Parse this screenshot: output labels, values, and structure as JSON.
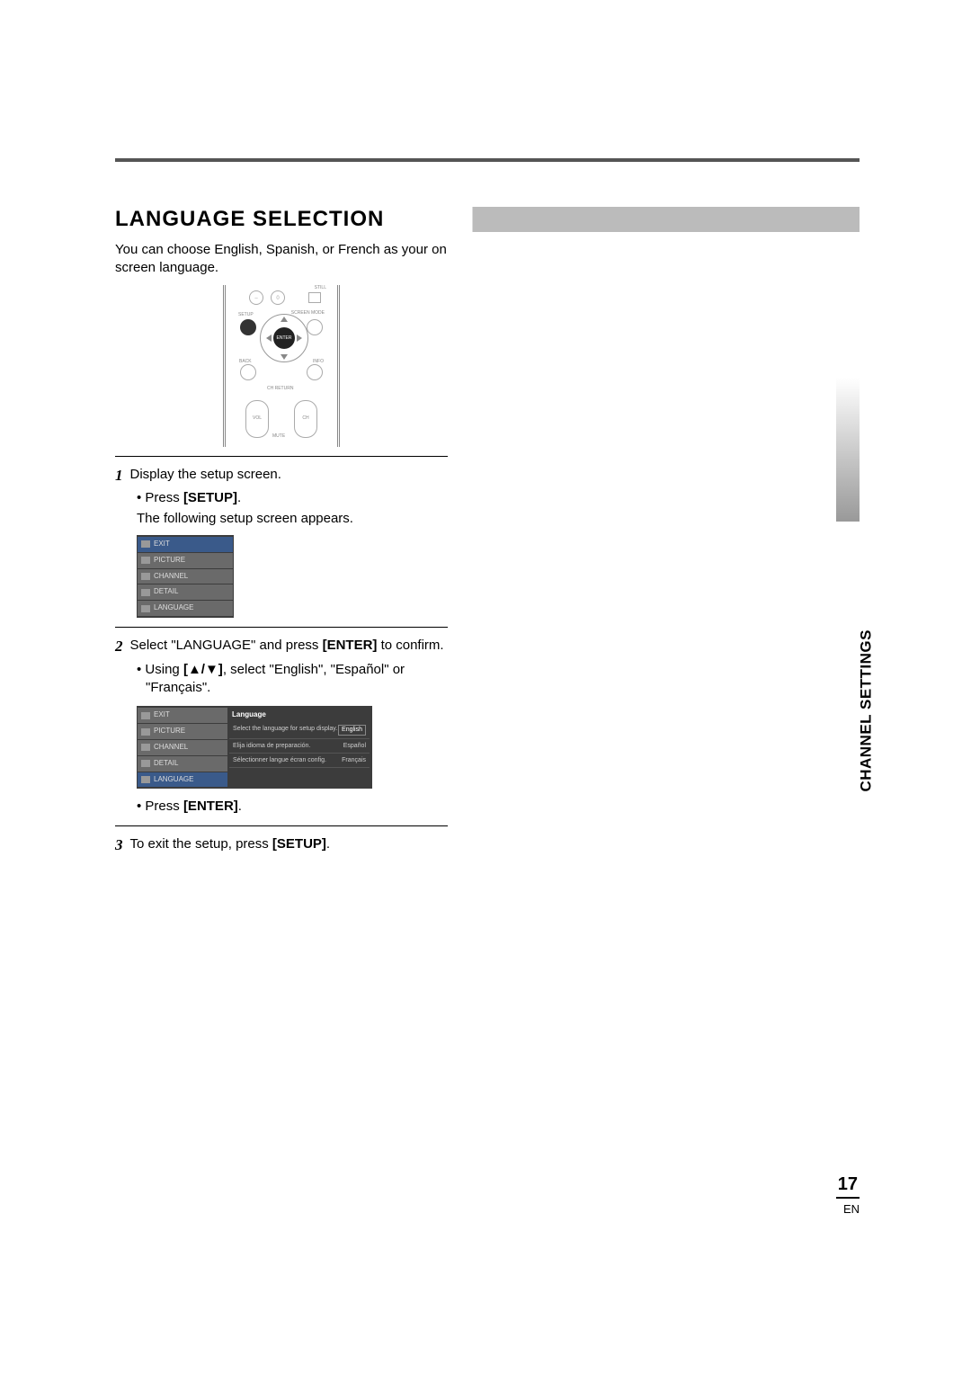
{
  "section_title": "LANGUAGE SELECTION",
  "intro": "You can choose English, Spanish, or French as your on screen language.",
  "remote": {
    "still": "STILL",
    "setup": "SETUP",
    "screen": "SCREEN MODE",
    "enter": "ENTER",
    "back": "BACK",
    "info": "INFO",
    "return": "CH RETURN",
    "vol": "VOL",
    "ch": "CH",
    "mute": "MUTE"
  },
  "step1": {
    "num": "1",
    "text": "Display the setup screen.",
    "bullet1a": "Press ",
    "bullet1b": "[SETUP]",
    "bullet1c": ".",
    "sub": "The following setup screen appears."
  },
  "menu": {
    "items": [
      "EXIT",
      "PICTURE",
      "CHANNEL",
      "DETAIL",
      "LANGUAGE"
    ]
  },
  "step2": {
    "num": "2",
    "text_a": "Select \"LANGUAGE\" and press ",
    "text_b": "[ENTER]",
    "text_c": " to confirm.",
    "bullet_a": "Using ",
    "bullet_b": "[▲/▼]",
    "bullet_c": ", select \"English\", \"Español\" or \"Français\".",
    "press_a": "Press ",
    "press_b": "[ENTER]",
    "press_c": "."
  },
  "lang_panel": {
    "header": "Language",
    "rows": [
      {
        "desc": "Select the language for setup display.",
        "val": "English",
        "selected": true
      },
      {
        "desc": "Elija idioma de preparación.",
        "val": "Español",
        "selected": false
      },
      {
        "desc": "Sélectionner langue écran config.",
        "val": "Français",
        "selected": false
      }
    ]
  },
  "step3": {
    "num": "3",
    "text_a": "To exit the setup, press ",
    "text_b": "[SETUP]",
    "text_c": "."
  },
  "side_tab": "CHANNEL SETTINGS",
  "page_number": "17",
  "page_lang": "EN"
}
